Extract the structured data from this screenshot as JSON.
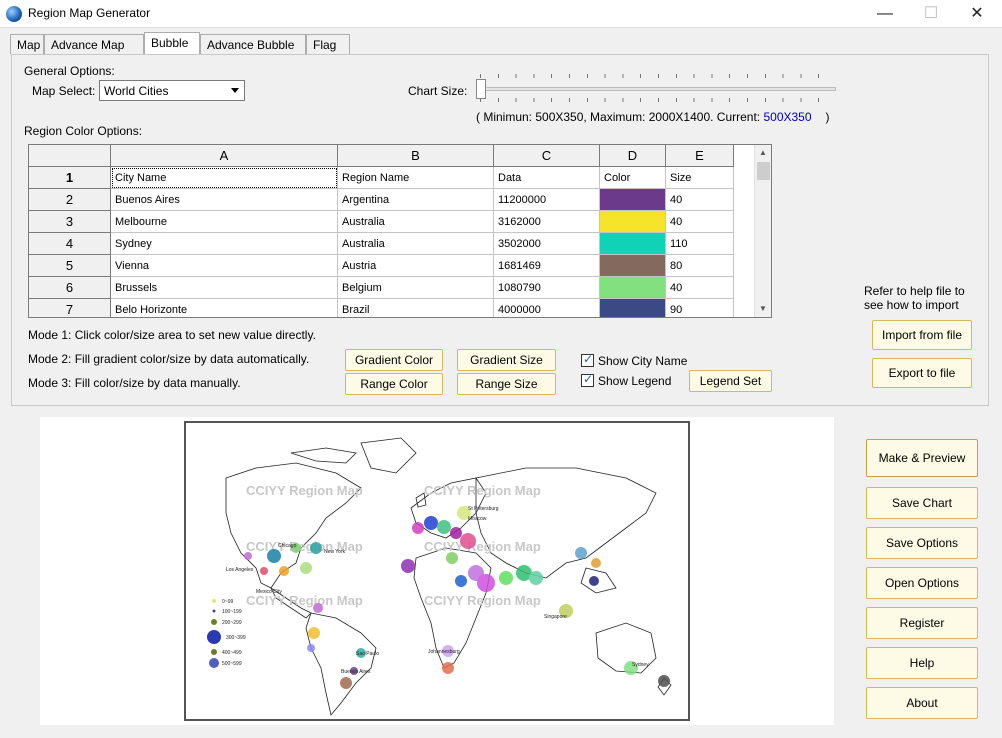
{
  "window": {
    "title": "Region Map Generator",
    "minimize": "—",
    "maximize": "☐",
    "close": "✕"
  },
  "tabs": [
    {
      "label": "Map",
      "active": false
    },
    {
      "label": "Advance Map",
      "active": false
    },
    {
      "label": "Bubble",
      "active": true
    },
    {
      "label": "Advance Bubble",
      "active": false
    },
    {
      "label": "Flag",
      "active": false
    }
  ],
  "general": {
    "heading": "General Options:",
    "map_select_label": "Map Select:",
    "map_select_value": "World Cities",
    "chart_size_label": "Chart Size:",
    "size_info_prefix": "( Minimun: 500X350, Maximum: 2000X1400.  Current: ",
    "size_current": "500X350",
    "size_info_suffix": ")"
  },
  "region_color_heading": "Region Color Options:",
  "grid": {
    "columns": [
      "A",
      "B",
      "C",
      "D",
      "E"
    ],
    "rows": [
      {
        "num": "1",
        "a": "City Name",
        "b": "Region Name",
        "c": "Data",
        "d": "Color",
        "e": "Size",
        "color": ""
      },
      {
        "num": "2",
        "a": "Buenos Aires",
        "b": "Argentina",
        "c": "11200000",
        "d": "",
        "e": "40",
        "color": "#6b3a8a"
      },
      {
        "num": "3",
        "a": "Melbourne",
        "b": "Australia",
        "c": "3162000",
        "d": "",
        "e": "40",
        "color": "#f6e42a"
      },
      {
        "num": "4",
        "a": "Sydney",
        "b": "Australia",
        "c": "3502000",
        "d": "",
        "e": "110",
        "color": "#10d2b4"
      },
      {
        "num": "5",
        "a": "Vienna",
        "b": "Austria",
        "c": "1681469",
        "d": "",
        "e": "80",
        "color": "#84695f"
      },
      {
        "num": "6",
        "a": "Brussels",
        "b": "Belgium",
        "c": "1080790",
        "d": "",
        "e": "40",
        "color": "#82e07e"
      },
      {
        "num": "7",
        "a": "Belo Horizonte",
        "b": "Brazil",
        "c": "4000000",
        "d": "",
        "e": "90",
        "color": "#3b4a84"
      }
    ]
  },
  "modes": [
    "Mode 1: Click color/size area to set new value directly.",
    "Mode 2: Fill gradient color/size by data automatically.",
    "Mode 3: Fill color/size by data manually."
  ],
  "buttons": {
    "gradient_color": "Gradient Color",
    "gradient_size": "Gradient Size",
    "range_color": "Range Color",
    "range_size": "Range Size",
    "legend_set": "Legend Set",
    "import": "Import from file",
    "export": "Export to file",
    "make_preview": "Make & Preview",
    "save_chart": "Save Chart",
    "save_options": "Save Options",
    "open_options": "Open Options",
    "register": "Register",
    "help": "Help",
    "about": "About"
  },
  "checkboxes": {
    "show_city_name": "Show City Name",
    "show_legend": "Show Legend"
  },
  "help_note_line1": "Refer to help file to",
  "help_note_line2": "see how to import",
  "preview": {
    "watermark": "CCIYY Region Map",
    "legend": [
      "0~99",
      "100~199",
      "200~299",
      "300~399",
      "400~499",
      "500~599"
    ],
    "labels": [
      "St Petersburg",
      "Moscow",
      "Chicago",
      "New York",
      "Los Angeles",
      "Mexico City",
      "Sao Paulo",
      "Buenos Aires",
      "Johannesburg",
      "Singapore",
      "Sydney"
    ]
  }
}
